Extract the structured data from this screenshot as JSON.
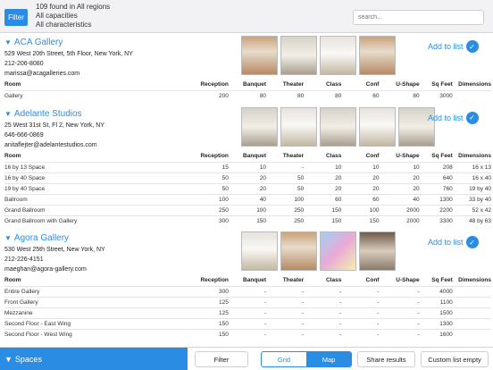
{
  "header": {
    "filter_label": "Filter",
    "found_line": "109 found in All regions",
    "capacities_line": "All capacities",
    "characteristics_line": "All characteristics",
    "search_placeholder": "search..."
  },
  "columns": [
    "Room",
    "Reception",
    "Banquet",
    "Theater",
    "Class",
    "Conf",
    "U-Shape",
    "Sq Feet",
    "Dimensions"
  ],
  "venues": [
    {
      "name": "ACA Gallery",
      "address": "529 West 20th Street, 5th Floor, New York, NY",
      "phone": "212-206-8080",
      "email": "marissa@acagalleries.com",
      "add_label": "Add to list",
      "rooms": [
        [
          "Gallery",
          "200",
          "80",
          "80",
          "80",
          "60",
          "80",
          "3000",
          ""
        ]
      ]
    },
    {
      "name": "Adelante Studios",
      "address": "25 West 31st St, Fl 2, New York, NY",
      "phone": "646-666-0869",
      "email": "anitaflejter@adelantestudios.com",
      "add_label": "Add to list",
      "rooms": [
        [
          "16 by 13 Space",
          "15",
          "10",
          "-",
          "10",
          "10",
          "10",
          "208",
          "16 x 13"
        ],
        [
          "16 by 40 Space",
          "50",
          "20",
          "50",
          "20",
          "20",
          "20",
          "640",
          "16 x 40"
        ],
        [
          "19 by 40 Space",
          "50",
          "20",
          "50",
          "20",
          "20",
          "20",
          "760",
          "19 by 40"
        ],
        [
          "Ballroom",
          "100",
          "40",
          "100",
          "60",
          "60",
          "40",
          "1300",
          "33 by 40"
        ],
        [
          "Grand Ballroom",
          "250",
          "100",
          "250",
          "150",
          "100",
          "2000",
          "2200",
          "52 x 42"
        ],
        [
          "Grand Ballroom with Gallery",
          "300",
          "150",
          "250",
          "150",
          "150",
          "2000",
          "3300",
          "48 by 63"
        ]
      ]
    },
    {
      "name": "Agora Gallery",
      "address": "530 West 25th Street, New York, NY",
      "phone": "212-226-4151",
      "email": "maeghan@agora-gallery.com",
      "add_label": "Add to list",
      "rooms": [
        [
          "Entire Gallery",
          "300",
          "-",
          "-",
          "-",
          "-",
          "-",
          "4000",
          ""
        ],
        [
          "Front Gallery",
          "125",
          "-",
          "-",
          "-",
          "-",
          "-",
          "1100",
          ""
        ],
        [
          "Mezzanine",
          "125",
          "-",
          "-",
          "-",
          "-",
          "-",
          "1500",
          ""
        ],
        [
          "Second Floor - East Wing",
          "150",
          "-",
          "-",
          "-",
          "-",
          "-",
          "1300",
          ""
        ],
        [
          "Second Floor - West Wing",
          "150",
          "-",
          "-",
          "-",
          "-",
          "-",
          "1600",
          ""
        ]
      ]
    }
  ],
  "bottom": {
    "spaces_label": "Spaces",
    "filter_label": "Filter",
    "grid_label": "Grid",
    "map_label": "Map",
    "share_label": "Share results",
    "custom_label": "Custom list empty"
  },
  "colors": {
    "accent": "#2a8de3"
  }
}
